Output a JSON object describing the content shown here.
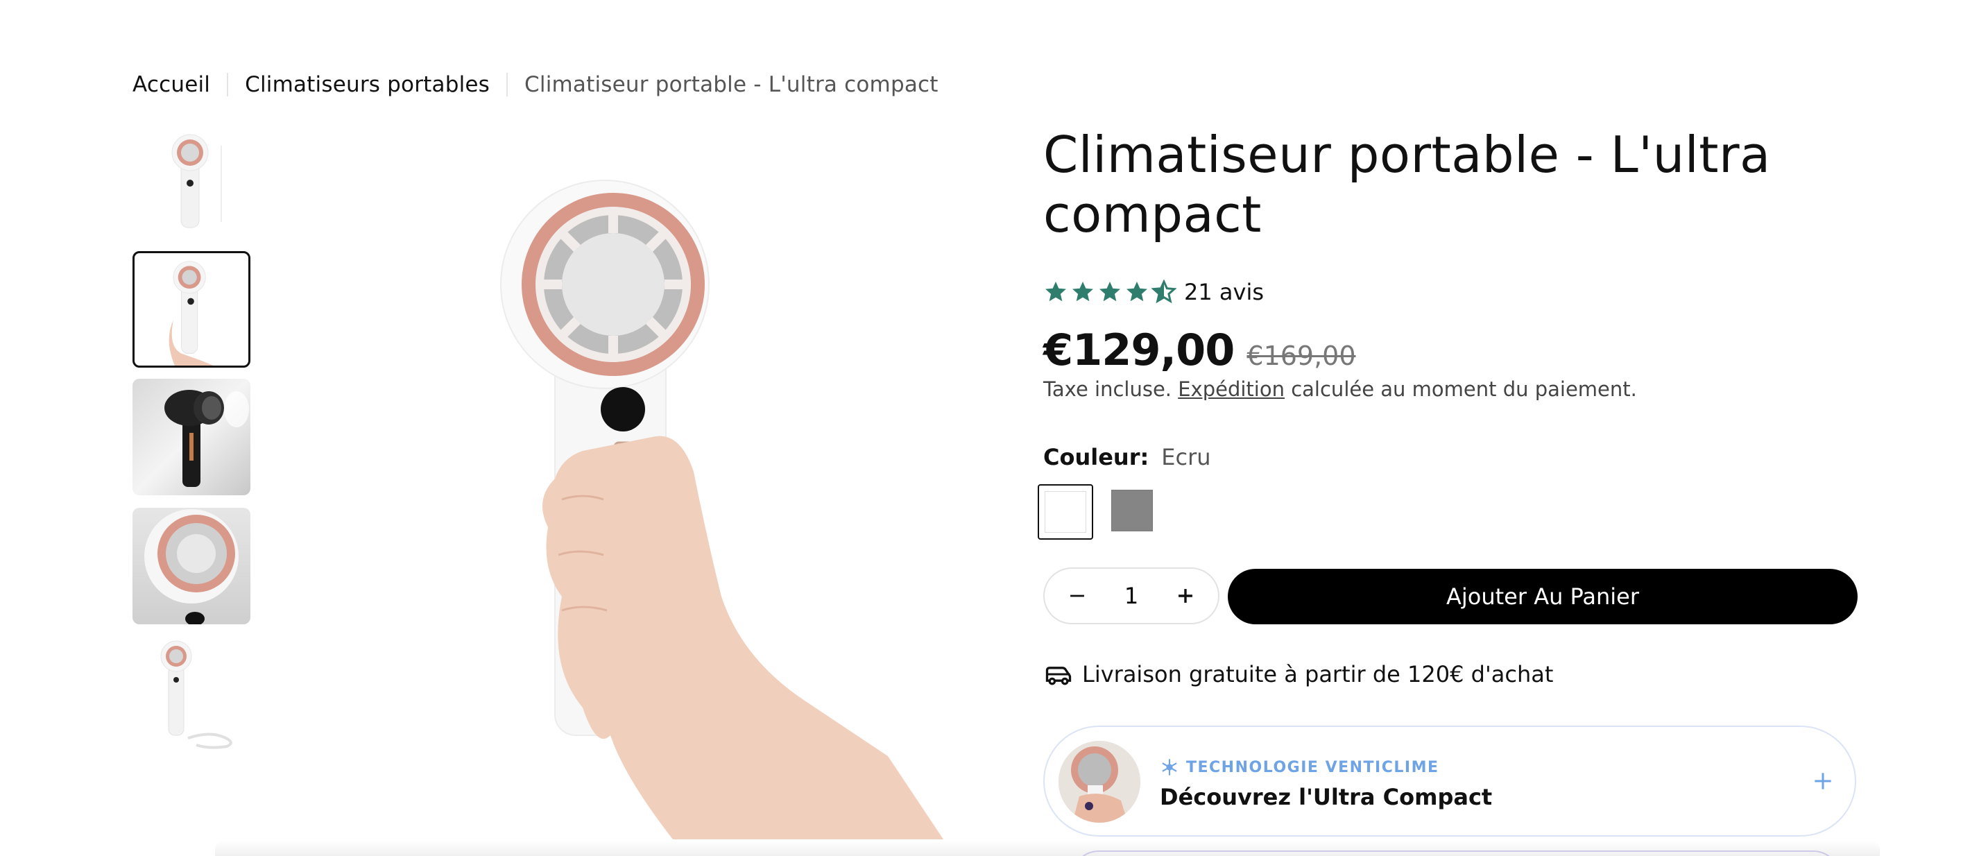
{
  "breadcrumb": {
    "home": "Accueil",
    "category": "Climatiseurs portables",
    "current": "Climatiseur portable - L'ultra compact"
  },
  "product": {
    "title": "Climatiseur portable - L'ultra compact",
    "rating": 4.5,
    "reviews_label": "21 avis",
    "price": "€129,00",
    "compare_price": "€169,00",
    "tax_before": "Taxe incluse. ",
    "tax_link": "Expédition",
    "tax_after": " calculée au moment du paiement.",
    "color_label": "Couleur:",
    "color_value": "Ecru",
    "swatches": [
      {
        "name": "Ecru",
        "color": "#ffffff",
        "selected": true
      },
      {
        "name": "Gris",
        "color": "#858585",
        "selected": false
      }
    ],
    "quantity": "1",
    "add_to_cart": "Ajouter Au Panier",
    "shipping": "Livraison gratuite à partir de 120€ d'achat"
  },
  "promo": {
    "kicker": "TECHNOLOGIE VENTICLIME",
    "title": "Découvrez l'Ultra Compact"
  },
  "colors": {
    "star": "#2f7d6d",
    "accent_blue": "#6ea3e6",
    "copper": "#d9998a"
  },
  "icons": [
    "star-icon",
    "minus-icon",
    "plus-icon",
    "truck-icon",
    "snowflake-icon"
  ]
}
